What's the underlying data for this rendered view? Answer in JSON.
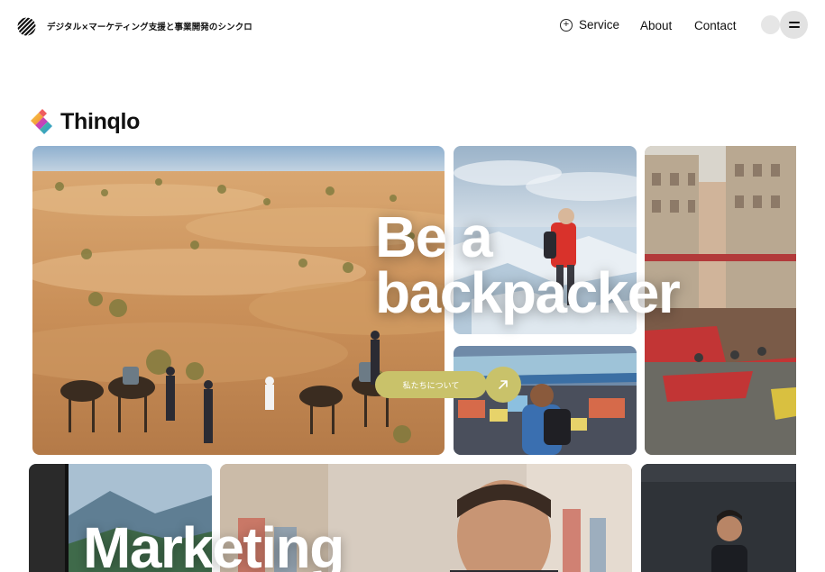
{
  "header": {
    "tagline": "デジタル×マーケティング支援と事業開発のシンクロ",
    "nav": {
      "service": "Service",
      "about": "About",
      "contact": "Contact"
    }
  },
  "brand": {
    "name": "Thinqlo"
  },
  "hero": {
    "title_line1": "Be a",
    "title_line2": "backpacker",
    "cta_label": "私たちについて"
  },
  "section": {
    "title": "Marketing"
  },
  "colors": {
    "accent": "#c9c26a",
    "text": "#111111",
    "background": "#ffffff"
  },
  "icons": {
    "site_mark": "hatched-circle-icon",
    "service": "plus-circle-icon",
    "menu": "hamburger-icon",
    "cta": "arrow-up-right-icon",
    "brand_logo": "gradient-diamond-logo"
  }
}
